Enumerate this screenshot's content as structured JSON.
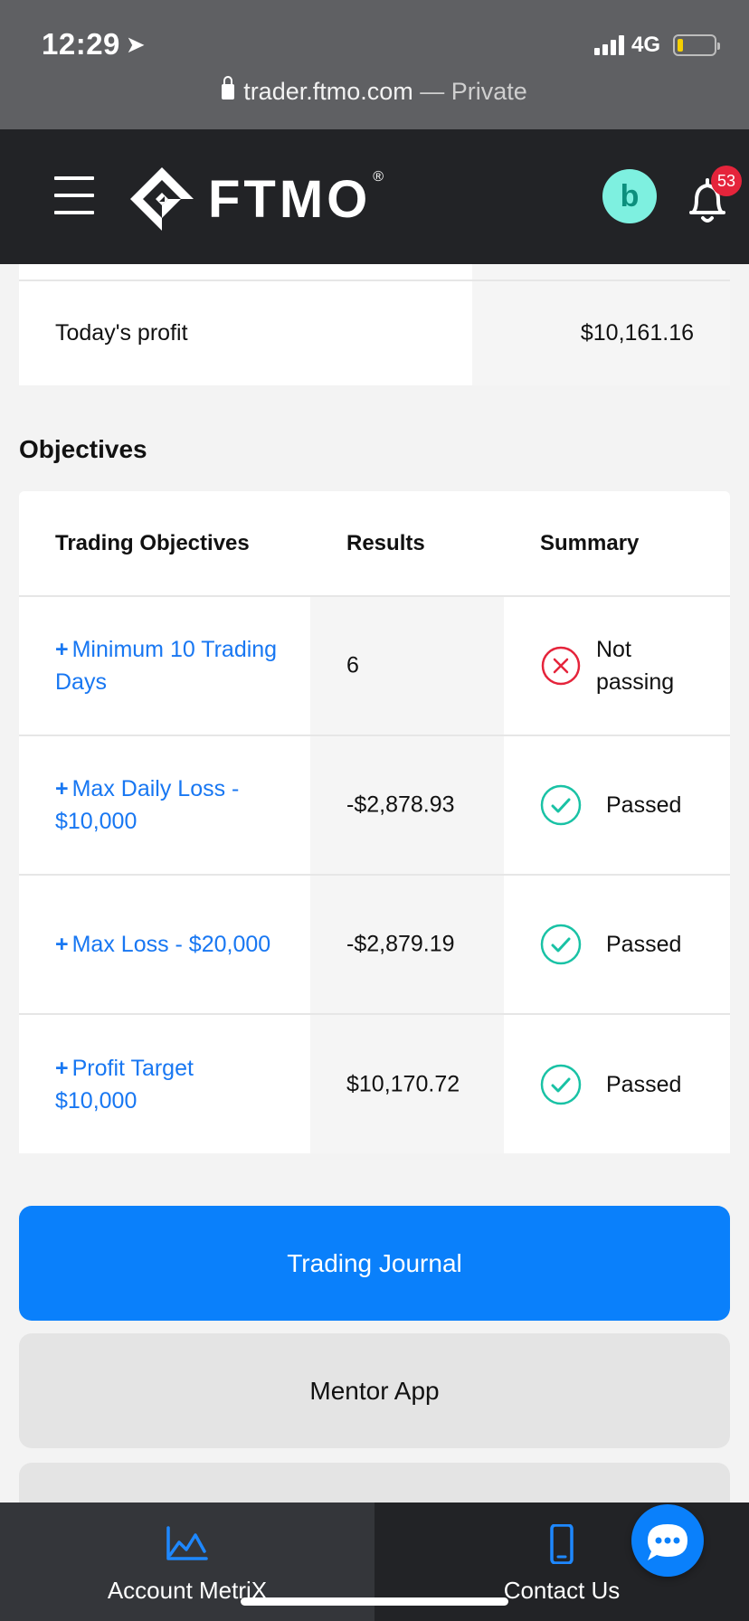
{
  "status_bar": {
    "time": "12:29",
    "network": "4G",
    "url": "trader.ftmo.com",
    "url_suffix": " — Private"
  },
  "header": {
    "logo_text": "FTMO",
    "logo_reg": "®",
    "avatar_letter": "b",
    "notification_count": "53"
  },
  "account_summary": {
    "label": "Today's profit",
    "value": "$10,161.16"
  },
  "objectives": {
    "title": "Objectives",
    "columns": [
      "Trading Objectives",
      "Results",
      "Summary"
    ],
    "rows": [
      {
        "name": "Minimum 10 Trading Days",
        "result": "6",
        "status": "Not passing",
        "status_icon": "x-circle-icon"
      },
      {
        "name": "Max Daily Loss - $10,000",
        "result": "-$2,878.93",
        "status": "Passed",
        "status_icon": "check-circle-icon"
      },
      {
        "name": "Max Loss - $20,000",
        "result": "-$2,879.19",
        "status": "Passed",
        "status_icon": "check-circle-icon"
      },
      {
        "name": "Profit Target $10,000",
        "result": "$10,170.72",
        "status": "Passed",
        "status_icon": "check-circle-icon"
      }
    ],
    "plus_symbol": "+"
  },
  "buttons": {
    "trading_journal": "Trading Journal",
    "mentor_app": "Mentor App"
  },
  "bottom_nav": {
    "account_metrix": "Account MetriX",
    "contact_us": "Contact Us"
  },
  "colors": {
    "accent": "#0a80fb",
    "link": "#1877f2",
    "pass": "#19c2a5",
    "fail": "#e5243b"
  }
}
